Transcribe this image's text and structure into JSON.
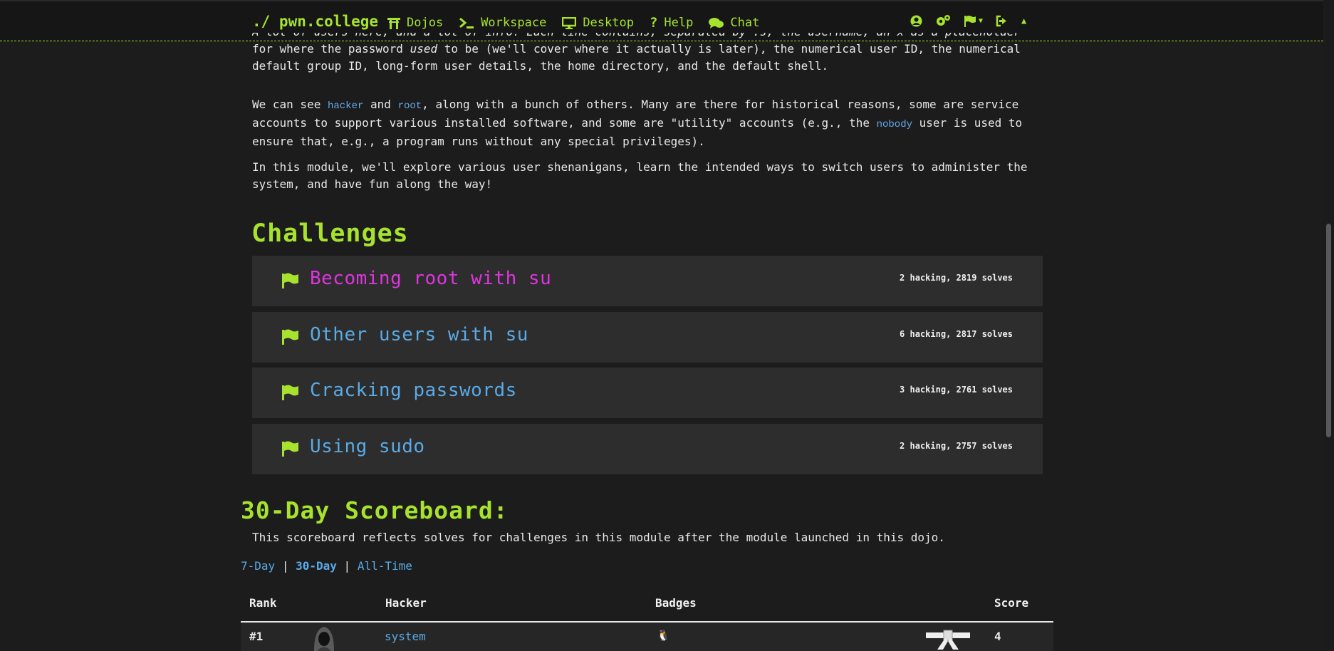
{
  "nav": {
    "brand": "./ pwn.college",
    "links": [
      {
        "label": "Dojos",
        "icon": "torii-icon"
      },
      {
        "label": "Workspace",
        "icon": "terminal-icon"
      },
      {
        "label": "Desktop",
        "icon": "desktop-icon"
      },
      {
        "label": "Help",
        "icon": "question-icon"
      },
      {
        "label": "Chat",
        "icon": "comments-icon"
      }
    ],
    "right_icons": [
      "user-circle-icon",
      "gears-icon",
      "flag-dropdown-icon",
      "sign-out-icon",
      "caret-up-icon"
    ]
  },
  "intro": {
    "p1_partial": "A lot of users here, and a lot of info! Each line contains, separated by :s, the username, an x as a placeholder",
    "p1_a": "for where the password ",
    "p1_em": "used",
    "p1_b": " to be (we'll cover where it actually is later), the numerical user ID, the numerical",
    "p1_c": "default group ID, long-form user details, the home directory, and the default shell.",
    "p2_a": "We can see ",
    "p2_hacker": "hacker",
    "p2_and": " and ",
    "p2_root": "root",
    "p2_b": ", along with a bunch of others. Many are there for historical reasons, some are service",
    "p2_c": "accounts to support various installed software, and some are \"utility\" accounts (e.g., the ",
    "p2_nobody": "nobody",
    "p2_d": " user is used to",
    "p2_e": "ensure that, e.g., a program runs without any special privileges).",
    "p3_a": "In this module, we'll explore various user shenanigans, learn the intended ways to switch users to administer the",
    "p3_b": "system, and have fun along the way!"
  },
  "challenges": {
    "heading": "Challenges",
    "items": [
      {
        "title": "Becoming root with su",
        "stats": "2 hacking, 2819 solves",
        "color": "#e034e0"
      },
      {
        "title": "Other users with su",
        "stats": "6 hacking, 2817 solves",
        "color": "#5aaae6"
      },
      {
        "title": "Cracking passwords",
        "stats": "3 hacking, 2761 solves",
        "color": "#5aaae6"
      },
      {
        "title": "Using sudo",
        "stats": "2 hacking, 2757 solves",
        "color": "#5aaae6"
      }
    ]
  },
  "scoreboard": {
    "heading": "30-Day Scoreboard:",
    "description": "This scoreboard reflects solves for challenges in this module after the module launched in this dojo.",
    "ranges": [
      "7-Day",
      "30-Day",
      "All-Time"
    ],
    "separator": "|",
    "active_range": "30-Day",
    "columns": [
      "Rank",
      "Hacker",
      "Badges",
      "Score"
    ],
    "rows": [
      {
        "rank": "#1",
        "hacker": "system",
        "badge": "🐧",
        "score": "4"
      }
    ]
  },
  "colors": {
    "accent": "#a6e22e",
    "link": "#5aaae6",
    "active_challenge": "#e034e0",
    "background": "#1c1c1c",
    "card": "#2d2d2d"
  }
}
